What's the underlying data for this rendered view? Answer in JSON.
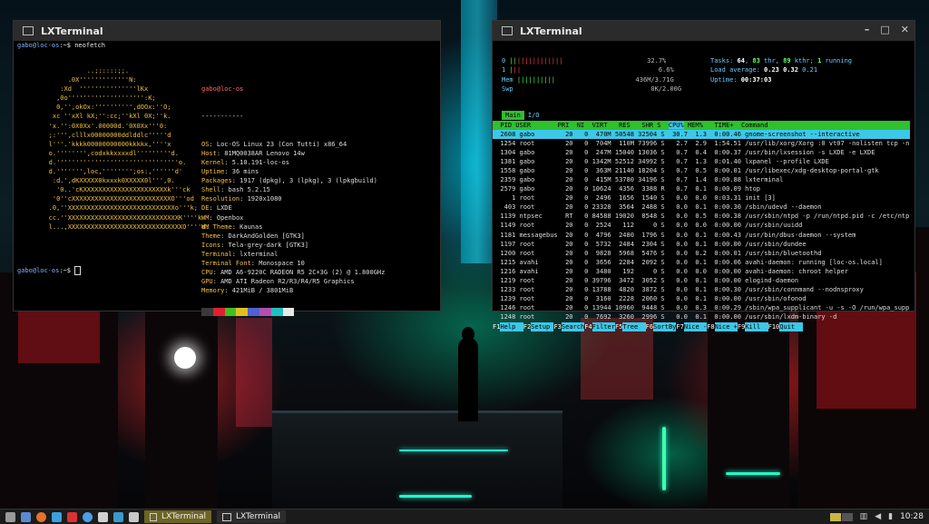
{
  "left_window": {
    "title": "LXTerminal",
    "prompt1_user": "gabo@loc-os",
    "prompt1_rest": ":~$ neofetch",
    "art": "             ..;:::::;;.\n        .0X'''''''''''''N:\n      :Xd  '''''''''''''''lKx\n     ,0o'''''''''''''''''''':K;\n     0,'',okOx:'''''''''',dOOx:''O;\n    xc ''xXl kX;'':cc;''kXl 0X;''k.\n   'x.'':0X0Xx'.00000d.'0X0Xx'''0:\n   ;:''',clllx00000000ddlddlc'''''d\n   l'''.'kkkk00000000000kkkkx,''''x\n   o.'''''''',codxkkxxxxdl'''''''''d.\n   d.''''''''''''''''''''''''''''''''o.\n   d.''''''',loc,'''''''';os:,''''''d'\n    :d.',dKXXXXX0kxxxk0XXXXX0l''',0.\n     '0..'cKXXXXXXXXXXXXXXXXXXXXXXk'''ck\n    '0''cXXXXXXXXXXXXXXXXXXXXXXXXXXO'''od\n   .0,''XXXXXXXXXXXXXXXXXXXXXXXXXXXXo'''k;\n   cc.''XXXXXXXXXXXXXXXXXXXXXXXXXXXXXK''''k\n   l...,XXXXXXXXXXXXXXXXXXXXXXXXXXXXXXO''''d.",
    "info_user": "gabo@loc-os",
    "separator": "-----------",
    "info": [
      {
        "k": "OS",
        "v": "Loc-OS Linux 23 (Con Tutti) x86_64"
      },
      {
        "k": "Host",
        "v": "81MQ0038AR Lenovo 14w"
      },
      {
        "k": "Kernel",
        "v": "5.10.191-loc-os"
      },
      {
        "k": "Uptime",
        "v": "36 mins"
      },
      {
        "k": "Packages",
        "v": "1917 (dpkg), 3 (lpkg), 3 (lpkgbuild)"
      },
      {
        "k": "Shell",
        "v": "bash 5.2.15"
      },
      {
        "k": "Resolution",
        "v": "1920x1080"
      },
      {
        "k": "DE",
        "v": "LXDE"
      },
      {
        "k": "WM",
        "v": "Openbox"
      },
      {
        "k": "WM Theme",
        "v": "Kaunas"
      },
      {
        "k": "Theme",
        "v": "DarkAndGolden [GTK3]"
      },
      {
        "k": "Icons",
        "v": "Tela-grey-dark [GTK3]"
      },
      {
        "k": "Terminal",
        "v": "lxterminal"
      },
      {
        "k": "Terminal Font",
        "v": "Monospace 10"
      },
      {
        "k": "CPU",
        "v": "AMD A6-9220C RADEON R5 2C+3G (2) @ 1.800GHz"
      },
      {
        "k": "GPU",
        "v": "AMD ATI Radeon R2/R3/R4/R5 Graphics"
      },
      {
        "k": "Memory",
        "v": "421MiB / 3801MiB"
      }
    ],
    "palette": [
      "#3a3a3a",
      "#e02030",
      "#40c020",
      "#e0c020",
      "#5060d0",
      "#b050b0",
      "#20c0c0",
      "#e8e8e8"
    ],
    "prompt2_user": "gabo@loc-os",
    "prompt2_rest": ":~$ "
  },
  "right_window": {
    "title": "LXTerminal",
    "meters": {
      "cpu0_label": "0",
      "cpu0_val": "32.7%",
      "cpu1_label": "1",
      "cpu1_val": "6.6%",
      "mem_label": "Mem",
      "mem_val": "436M/3.71G",
      "swp_label": "Swp",
      "swp_val": "0K/2.00G"
    },
    "stats": {
      "tasks_label": "Tasks: ",
      "tasks_a": "64",
      "tasks_b": "83",
      "tasks_thr": " thr, ",
      "tasks_c": "89",
      "tasks_kthr": " kthr; ",
      "tasks_d": "1",
      "tasks_run": " running",
      "load_label": "Load average: ",
      "load1": "0.23",
      "load5": "0.32",
      "load15": "0.21",
      "uptime_label": "Uptime: ",
      "uptime": "00:37:03"
    },
    "tabs": [
      "Main",
      "I/O"
    ],
    "header": "  PID USER       PRI  NI  VIRT   RES   SHR S  ",
    "header_sort": "CPU%",
    "header_rest": " MEM%   TIME+  Command",
    "processes": [
      "  2608 gabo        20   0  470M 50548 32504 S  30.7  1.3  0:00.46 gnome-screenshot --interactive",
      "  1254 root        20   0  704M  110M 73996 S   2.7  2.9  1:54.51 /usr/lib/xorg/Xorg :0 vt07 -nolisten tcp -n",
      "  1304 gabo        20   0  247M 15040 13036 S   0.7  0.4  0:00.37 /usr/bin/lxsession -s LXDE -e LXDE",
      "  1381 gabo        20   0 1342M 52512 34992 S   0.7  1.3  0:01.40 lxpanel --profile LXDE",
      "  1558 gabo        20   0  363M 21140 18204 S   0.7  0.5  0:00.01 /usr/libexec/xdg-desktop-portal-gtk",
      "  2359 gabo        20   0  415M 53780 34196 S   0.7  1.4  0:00.88 lxterminal",
      "  2579 gabo        20   0 10624  4356  3388 R   0.7  0.1  0:00.09 htop",
      "     1 root        20   0  2496  1656  1540 S   0.0  0.0  0:03.31 init [3]",
      "   403 root        20   0 23328  3564  2488 S   0.0  0.1  0:00.30 /sbin/udevd --daemon",
      "  1139 ntpsec      RT   0 84588 19020  8548 S   0.0  0.5  0:00.38 /usr/sbin/ntpd -p /run/ntpd.pid -c /etc/ntp",
      "  1149 root        20   0  2524   112     0 S   0.0  0.0  0:00.00 /usr/sbin/uuidd",
      "  1181 messagebus  20   0  4796  2480  1796 S   0.0  0.1  0:00.43 /usr/bin/dbus-daemon --system",
      "  1197 root        20   0  5732  2484  2304 S   0.0  0.1  0:00.00 /usr/sbin/dundee",
      "  1200 root        20   0  9828  5968  5476 S   0.0  0.2  0:00.01 /usr/sbin/bluetoothd",
      "  1215 avahi       20   0  3656  2284  2092 S   0.0  0.1  0:00.06 avahi-daemon: running [loc-os.local]",
      "  1216 avahi       20   0  3480   192     0 S   0.0  0.0  0:00.00 avahi-daemon: chroot helper",
      "  1219 root        20   0 39796  3472  3052 S   0.0  0.1  0:00.00 elogind-daemon",
      "  1233 root        20   0 13788  4820  3872 S   0.0  0.1  0:00.30 /usr/sbin/connmand --nodnsproxy",
      "  1239 root        20   0  3160  2228  2060 S   0.0  0.1  0:00.00 /usr/sbin/ofonod",
      "  1246 root        20   0 13944 10960  9448 S   0.0  0.3  0:00.29 /sbin/wpa_supplicant -u -s -O /run/wpa_supp",
      "  1248 root        20   0  7692  3260  2996 S   0.0  0.1  0:00.00 /usr/sbin/lxdm-binary -d"
    ],
    "fkeys": [
      {
        "key": "F1",
        "label": "Help  "
      },
      {
        "key": "F2",
        "label": "Setup "
      },
      {
        "key": "F3",
        "label": "Search"
      },
      {
        "key": "F4",
        "label": "Filter"
      },
      {
        "key": "F5",
        "label": "Tree  "
      },
      {
        "key": "F6",
        "label": "SortBy"
      },
      {
        "key": "F7",
        "label": "Nice -"
      },
      {
        "key": "F8",
        "label": "Nice +"
      },
      {
        "key": "F9",
        "label": "Kill  "
      },
      {
        "key": "F10",
        "label": "Quit  "
      }
    ]
  },
  "taskbar": {
    "tasks": [
      "LXTerminal",
      "LXTerminal"
    ],
    "clock": "10:28",
    "launcher_colors": [
      "#9a9a9a",
      "#5a8ad0",
      "#e8702a",
      "#3aa0e0",
      "#e03030",
      "#4aa0e8",
      "#d0d0d0",
      "#3a9ad0",
      "#c8c8c8"
    ]
  }
}
